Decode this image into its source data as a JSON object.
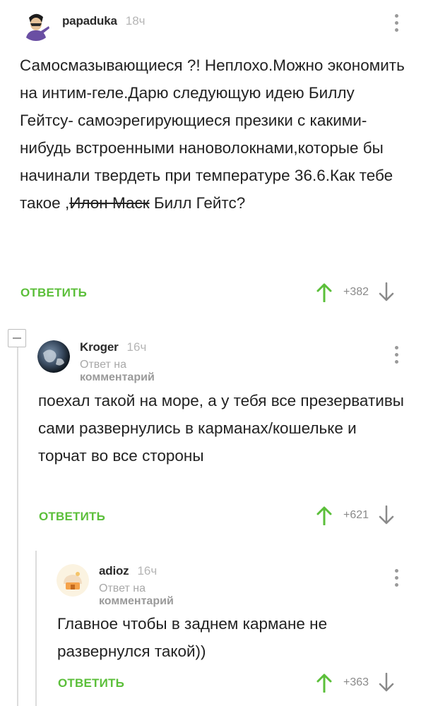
{
  "comments": [
    {
      "username": "papaduka",
      "time": "18ч",
      "text_main": "Самосмазывающиеся ?! Неплохо.Можно экономить на интим-геле.Дарю следующую идею Биллу Гейтсу- самоэрегирующиеся презики с какими-нибудь встроенными нановолокнами,которые бы начинали твердеть при температуре 36.6.Как тебе такое ,",
      "text_struck": "Илон Маск",
      "text_after": " Билл Гейтс?",
      "reply_label": "ОТВЕТИТЬ",
      "rating": "+382"
    },
    {
      "username": "Kroger",
      "time": "16ч",
      "reply_prefix": "Ответ на",
      "reply_target": "комментарий",
      "text": "поехал такой на море, а у тебя все презервативы сами развернулись в карманах/кошельке и торчат во все стороны",
      "reply_label": "ОТВЕТИТЬ",
      "rating": "+621"
    },
    {
      "username": "adioz",
      "time": "16ч",
      "reply_prefix": "Ответ на",
      "reply_target": "комментарий",
      "text": "Главное чтобы в заднем кармане не развернулся такой))",
      "reply_label": "ОТВЕТИТЬ",
      "rating": "+363"
    }
  ],
  "colors": {
    "accent": "#5bbf3a",
    "muted": "#a8a8a8",
    "text": "#222222"
  },
  "icons": [
    "more-options-icon",
    "upvote-icon",
    "downvote-icon",
    "collapse-thread-icon"
  ]
}
